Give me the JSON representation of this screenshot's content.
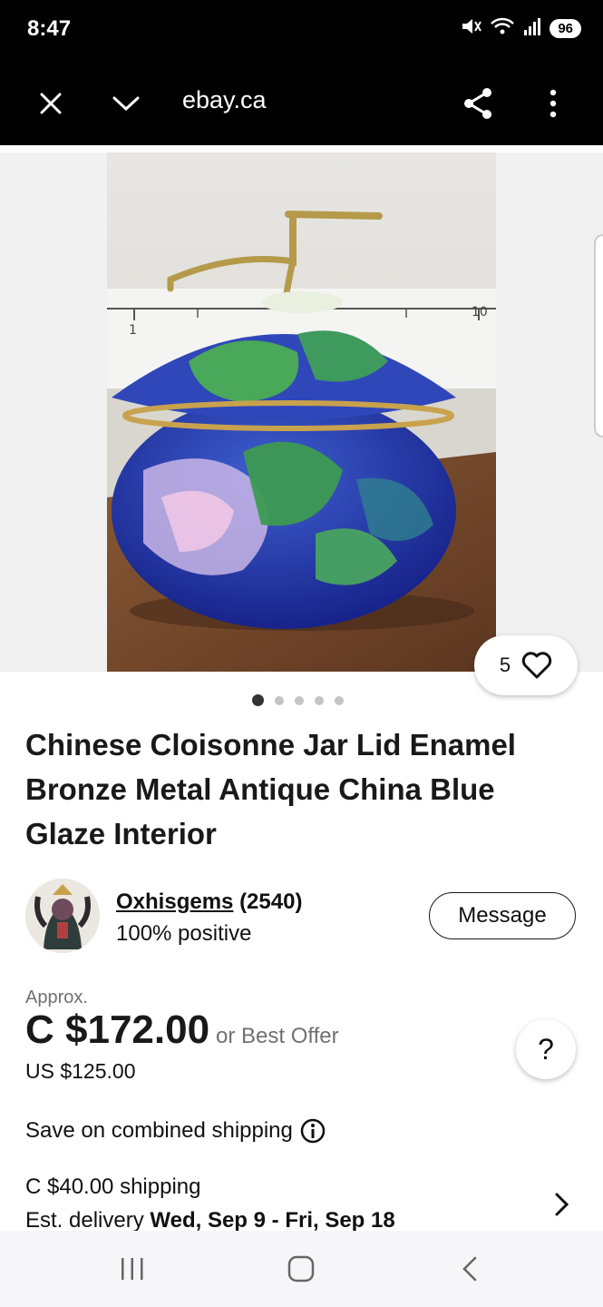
{
  "status_bar": {
    "time": "8:47",
    "battery": "96"
  },
  "browser": {
    "url": "ebay.ca"
  },
  "gallery": {
    "watch_count": "5",
    "image_count": 5,
    "active_index": 0,
    "photo_scale_label_left": "1",
    "photo_scale_label_right": "10"
  },
  "listing": {
    "title": "Chinese Cloisonne Jar Lid Enamel Bronze Metal Antique China Blue Glaze Interior",
    "seller_name": "Oxhisgems",
    "seller_feedback": "(2540)",
    "seller_positive": "100% positive",
    "message_label": "Message",
    "approx_label": "Approx.",
    "price": "C $172.00",
    "best_offer": "or Best Offer",
    "usd_price": "US $125.00",
    "help_label": "?",
    "combined_shipping": "Save on combined shipping",
    "shipping_cost": "C $40.00 shipping",
    "delivery_prefix": "Est. delivery",
    "delivery_dates": "Wed, Sep 9 - Fri, Sep 18"
  },
  "colors": {
    "bar": "#000000",
    "text": "#191919",
    "muted": "#707070",
    "enamel_blue": "#2438a8"
  }
}
